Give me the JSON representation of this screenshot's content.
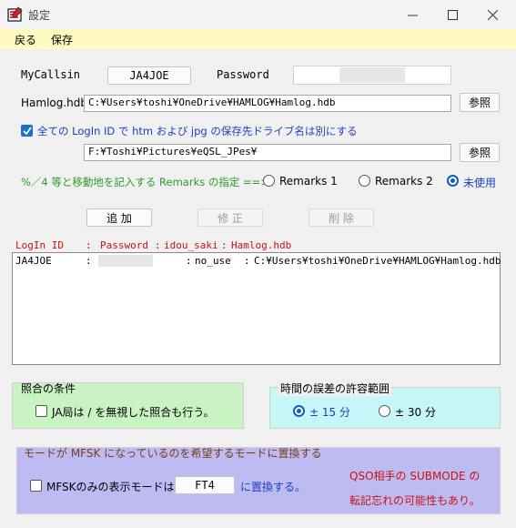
{
  "window": {
    "title": "設定"
  },
  "menu": {
    "back": "戻る",
    "save": "保存"
  },
  "callsign": {
    "label": "MyCallsin",
    "value": "JA4JOE"
  },
  "password": {
    "label": "Password"
  },
  "hamlog": {
    "label": "Hamlog.hdb",
    "value": "C:¥Users¥toshi¥OneDrive¥HAMLOG¥Hamlog.hdb",
    "browse": "参照"
  },
  "drive": {
    "checkbox_label": "全ての LogIn ID で htm および jpg の保存先ドライブ名は別にする",
    "checked": true,
    "value": "F:¥Toshi¥Pictures¥eQSL_JPes¥",
    "browse": "参照"
  },
  "remarks": {
    "label": "%／4 等と移動地を記入する Remarks の指定  ==>",
    "options": [
      "Remarks 1",
      "Remarks 2",
      "未使用"
    ],
    "selected": "未使用"
  },
  "actions": {
    "add": "追 加",
    "edit": "修 正",
    "delete": "削 除"
  },
  "list": {
    "headers": {
      "login_id": "LogIn ID",
      "sep1": ":",
      "password": "Password",
      "sep2": ":",
      "idou_saki": "idou_saki",
      "sep3": ":",
      "hamlog": "Hamlog.hdb"
    },
    "rows": [
      {
        "login_id": "JA4JOE",
        "sep1": ":",
        "sep2": ":",
        "idou_saki": "no_use",
        "sep3": ":",
        "hamlog": "C:¥Users¥toshi¥OneDrive¥HAMLOG¥Hamlog.hdb"
      }
    ]
  },
  "matching": {
    "title": "照合の条件",
    "checkbox_label": "JA局は / を無視した照合も行う。",
    "checked": false
  },
  "time_tolerance": {
    "title": "時間の誤差の許容範囲",
    "options": [
      "± 15 分",
      "± 30 分"
    ],
    "selected": "± 15 分"
  },
  "mfsk": {
    "title": "モードが MFSK になっているのを希望するモードに置換する",
    "checkbox_label": "MFSKのみの表示モードは",
    "checked": false,
    "mode_value": "FT4",
    "suffix": "に置換する。",
    "note_line1": "QSO相手の SUBMODE の",
    "note_line2": "転記忘れの可能性もあり。"
  },
  "colors": {
    "menubar": "#fffbc0",
    "green_text": "#2f9a2f",
    "red_text": "#cc1111",
    "blue_text": "#1a3fbf",
    "accent": "#1f6fc5"
  }
}
